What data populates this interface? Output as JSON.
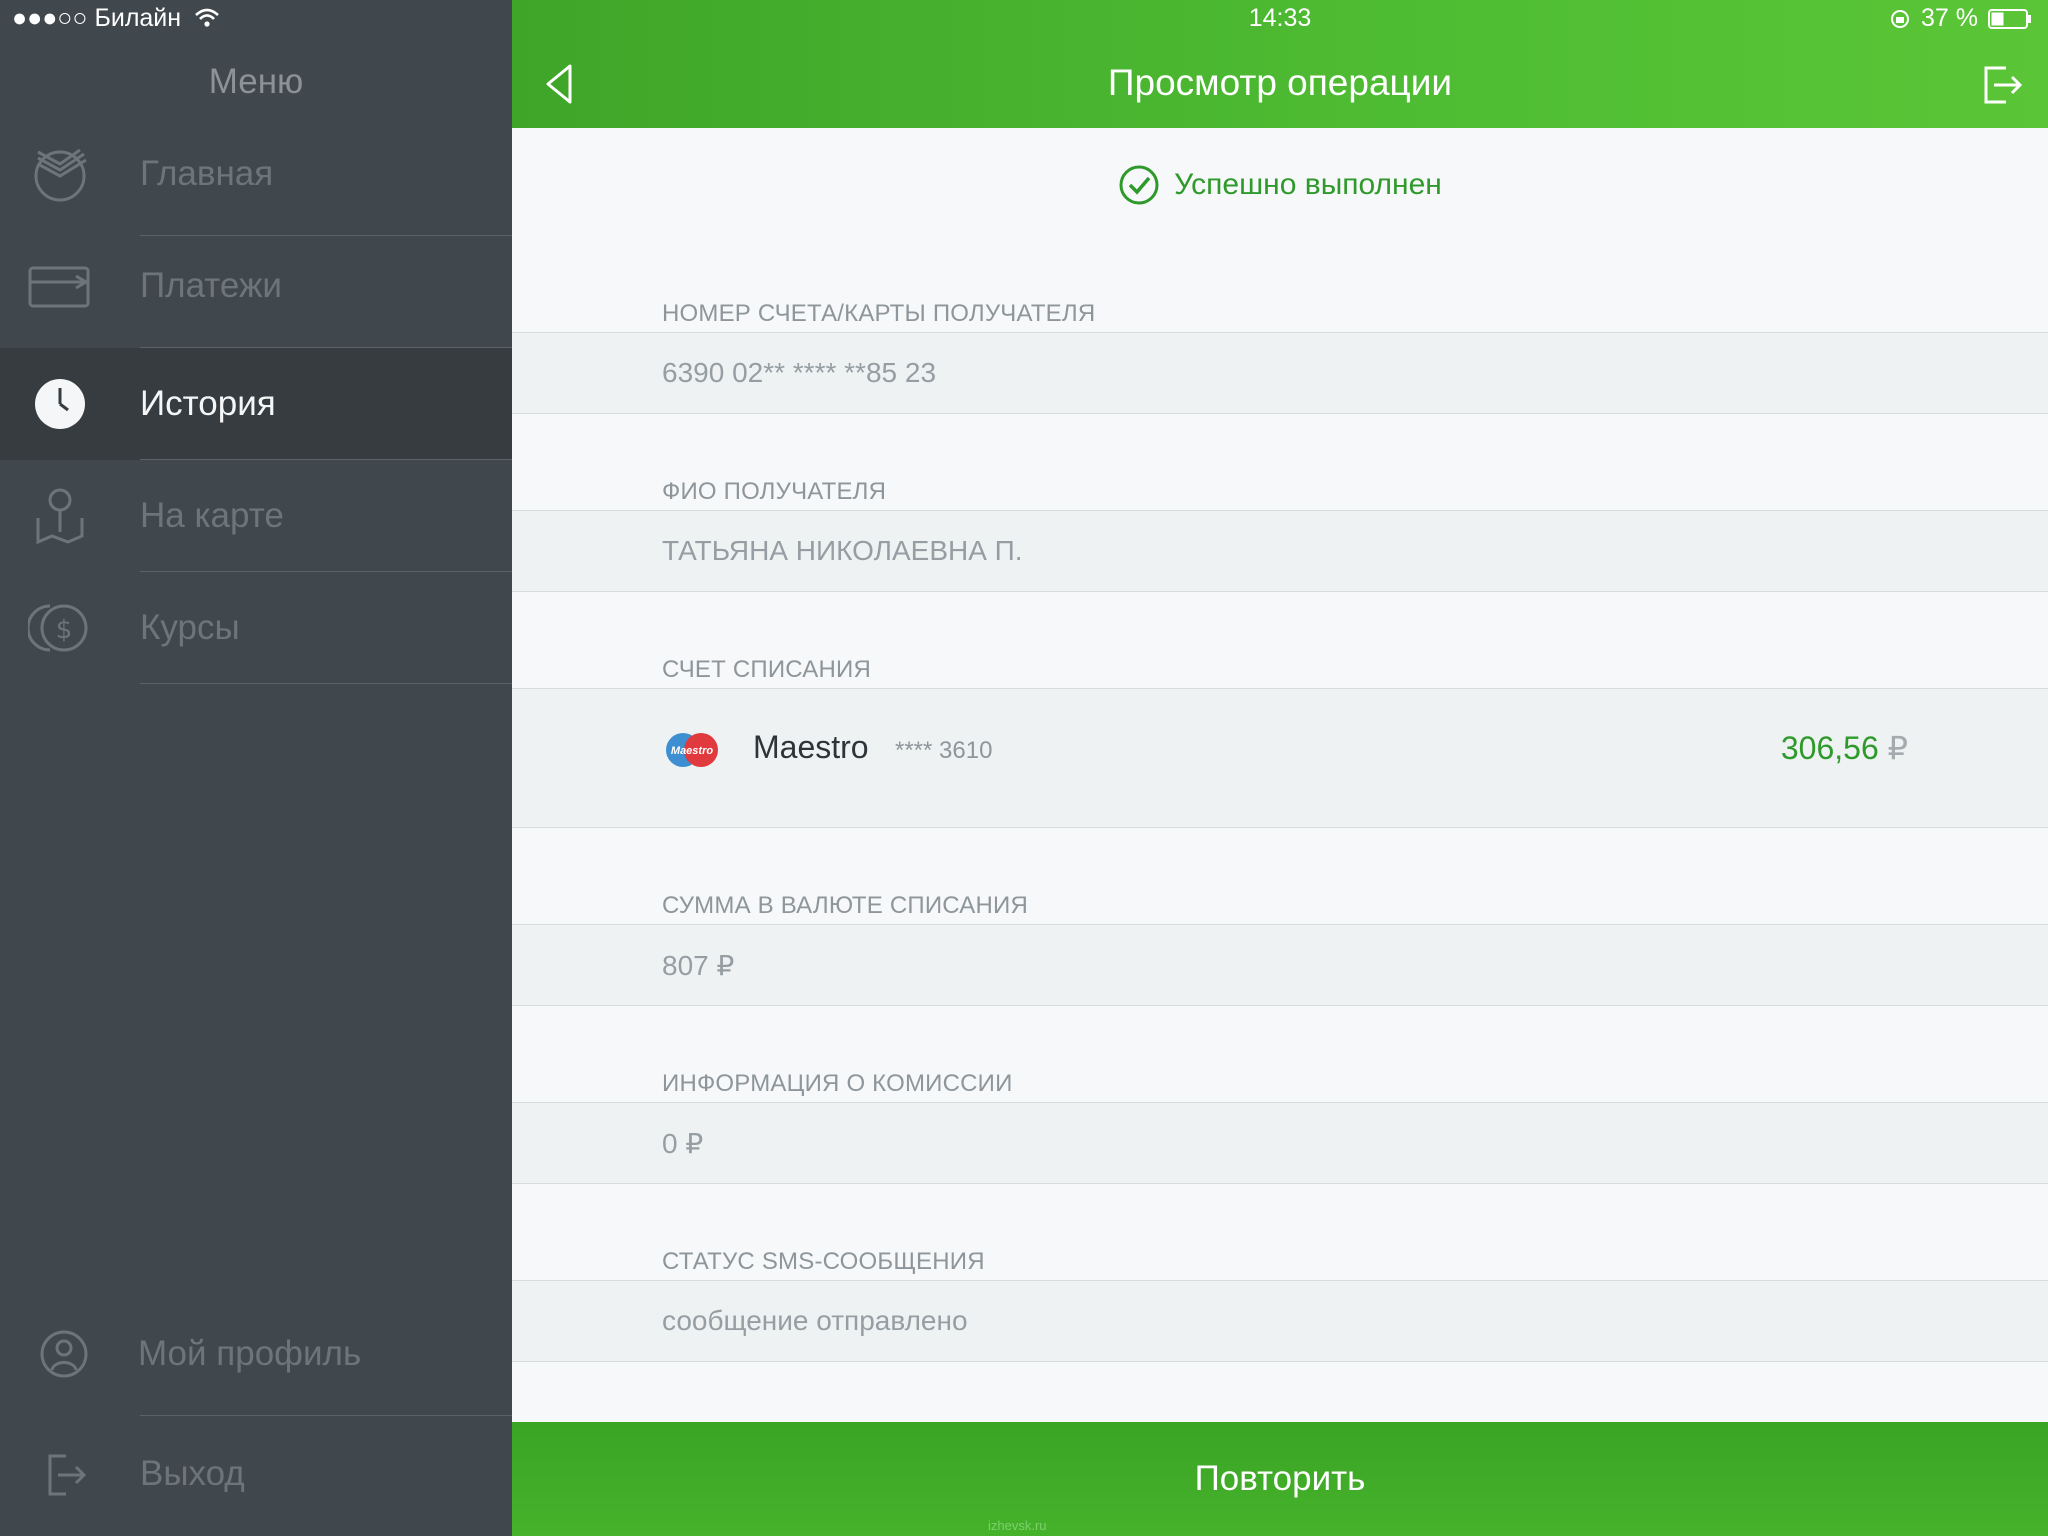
{
  "status_bar": {
    "carrier": "●●●○○ Билайн",
    "time": "14:33",
    "battery": "37 %"
  },
  "sidebar": {
    "title": "Меню",
    "items": [
      {
        "label": "Главная",
        "icon": "sberbank-logo-icon",
        "active": false
      },
      {
        "label": "Платежи",
        "icon": "card-transfer-icon",
        "active": false
      },
      {
        "label": "История",
        "icon": "clock-icon",
        "active": true
      },
      {
        "label": "На карте",
        "icon": "map-pin-icon",
        "active": false
      },
      {
        "label": "Курсы",
        "icon": "currency-icon",
        "active": false
      }
    ],
    "bottom_items": [
      {
        "label": "Мой профиль",
        "icon": "profile-icon"
      },
      {
        "label": "Выход",
        "icon": "logout-icon"
      }
    ]
  },
  "header": {
    "title": "Просмотр операции",
    "back_icon": "chevron-left-icon",
    "exit_icon": "exit-icon"
  },
  "operation": {
    "status": "Успешно выполнен",
    "fields": [
      {
        "label": "НОМЕР СЧЕТА/КАРТЫ ПОЛУЧАТЕЛЯ",
        "value": "6390 02** **** **85 23"
      },
      {
        "label": "ФИО ПОЛУЧАТЕЛЯ",
        "value": "ТАТЬЯНА НИКОЛАЕВНА П."
      },
      {
        "label": "СЧЕТ СПИСАНИЯ",
        "value": ""
      },
      {
        "label": "СУММА В ВАЛЮТЕ СПИСАНИЯ",
        "value": "807 ₽"
      },
      {
        "label": "ИНФОРМАЦИЯ О КОМИССИИ",
        "value": "0 ₽"
      },
      {
        "label": "СТАТУС SMS-СООБЩЕНИЯ",
        "value": "сообщение отправлено"
      }
    ],
    "card": {
      "logo_text": "Maestro",
      "name": "Maestro",
      "mask": "**** 3610",
      "amount": "306,56",
      "currency": "₽"
    }
  },
  "repeat_button": "Повторить",
  "watermark": "izhevsk.ru",
  "colors": {
    "accent_green": "#4fbd33",
    "sidebar_bg": "#41484d",
    "success_text": "#2f9a2b"
  }
}
